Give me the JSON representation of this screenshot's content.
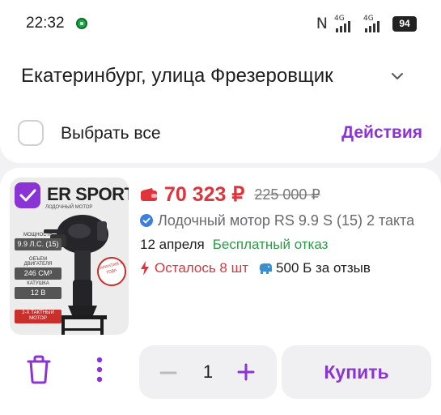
{
  "status_bar": {
    "time": "22:32",
    "net1": "4G",
    "net2": "4G",
    "battery": "94"
  },
  "header": {
    "address": "Екатеринбург, улица Фрезеровщик",
    "select_all": "Выбрать все",
    "actions": "Действия"
  },
  "product": {
    "image": {
      "brand": "ER SPORT",
      "sub": "ЛОДОЧНЫЙ МОТОР",
      "specs": [
        {
          "caption": "мощность",
          "value": "9.9 Л.С. (15)"
        },
        {
          "caption": "объем двигателя",
          "value": "246 СМ³"
        },
        {
          "caption": "катушка",
          "value": "12 В"
        },
        {
          "caption": "",
          "value": "2-Х ТАКТНЫЙ МОТОР"
        }
      ],
      "warranty": "ГАРАНТИЯ 3 ГОДА"
    },
    "price": "70 323 ₽",
    "old_price": "225 000 ₽",
    "title": "Лодочный мотор RS 9.9 S (15) 2 такта",
    "date": "12 апреля",
    "refund": "Бесплатный отказ",
    "stock": "Осталось 8 шт",
    "bonus": "500 Б за отзыв",
    "quantity": "1",
    "buy_label": "Купить"
  },
  "colors": {
    "accent": "#8b34d6",
    "price_red": "#e0333b",
    "green": "#2c9a47"
  }
}
